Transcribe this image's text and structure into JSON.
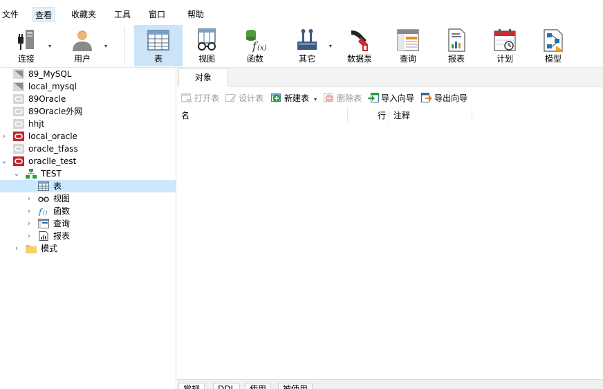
{
  "menu": {
    "items": [
      "文件",
      "查看",
      "收藏夹",
      "工具",
      "窗口",
      "帮助"
    ],
    "active": "查看"
  },
  "toolbar": {
    "buttons": [
      {
        "label": "连接",
        "icon": "plug-icon",
        "caret": true
      },
      {
        "label": "用户",
        "icon": "user-icon",
        "caret": true
      },
      {
        "label": "表",
        "icon": "table-icon",
        "selected": true
      },
      {
        "label": "视图",
        "icon": "view-icon"
      },
      {
        "label": "函数",
        "icon": "function-icon"
      },
      {
        "label": "其它",
        "icon": "tools-icon",
        "caret": true
      },
      {
        "label": "数据泵",
        "icon": "data-pump-icon"
      },
      {
        "label": "查询",
        "icon": "query-icon"
      },
      {
        "label": "报表",
        "icon": "report-icon"
      },
      {
        "label": "计划",
        "icon": "calendar-icon"
      },
      {
        "label": "模型",
        "icon": "model-icon"
      }
    ]
  },
  "tree": {
    "items": [
      {
        "label": "89_MySQL",
        "icon": "mysql-icon",
        "expanded": null
      },
      {
        "label": "local_mysql",
        "icon": "mysql-icon",
        "expanded": null
      },
      {
        "label": "89Oracle",
        "icon": "oracle-icon",
        "expanded": null
      },
      {
        "label": "89Oracle外网",
        "icon": "oracle-icon",
        "expanded": null
      },
      {
        "label": "hhjt",
        "icon": "oracle-icon",
        "expanded": null
      },
      {
        "label": "local_oracle",
        "icon": "oracle-connected-icon",
        "expanded": false
      },
      {
        "label": "oracle_tfass",
        "icon": "oracle-icon",
        "expanded": null
      },
      {
        "label": "oraclle_test",
        "icon": "oracle-connected-icon",
        "expanded": true
      },
      {
        "label": "TEST",
        "icon": "schema-icon",
        "expanded": true
      },
      {
        "label": "表",
        "icon": "table-small-icon",
        "expanded": null,
        "selected": true
      },
      {
        "label": "视图",
        "icon": "view-small-icon",
        "expanded": false
      },
      {
        "label": "函数",
        "icon": "function-small-icon",
        "expanded": false
      },
      {
        "label": "查询",
        "icon": "query-small-icon",
        "expanded": false
      },
      {
        "label": "报表",
        "icon": "report-small-icon",
        "expanded": false
      },
      {
        "label": "模式",
        "icon": "folder-icon",
        "expanded": false
      }
    ]
  },
  "objects_tab": {
    "label": "对象"
  },
  "object_toolbar": {
    "open_table": "打开表",
    "design_table": "设计表",
    "new_table": "新建表",
    "delete_table": "删除表",
    "import_wizard": "导入向导",
    "export_wizard": "导出向导"
  },
  "grid": {
    "columns": [
      "名",
      "行",
      "注释"
    ]
  },
  "bottom_tabs": [
    "常规",
    "DDL",
    "使用",
    "被使用"
  ],
  "colors": {
    "selected": "#cce4f7",
    "oracle_red": "#c0282d",
    "accent_blue": "#1e73be"
  }
}
